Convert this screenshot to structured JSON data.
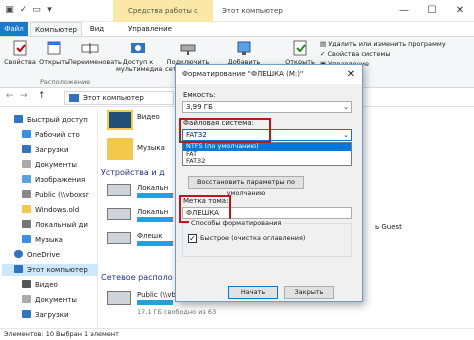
{
  "title_bar": {
    "context_tab": "Средства работы с дисками",
    "window_title": "Этот компьютер",
    "minimize": "—",
    "maximize": "☐",
    "close": "✕"
  },
  "tabs": [
    "Файл",
    "Компьютер",
    "Вид",
    "Управление"
  ],
  "ribbon": {
    "buttons": [
      "Свойства",
      "Открыть",
      "Переименовать",
      "Доступ к мультимедиа",
      "Подключить сетевой диск",
      "Добавить сетевое расположение",
      "Открыть"
    ],
    "group_label": "Расположение",
    "system_items": [
      "Удалить или изменить программу",
      "Свойства системы",
      "Управление"
    ]
  },
  "address": {
    "path": "Этот компьютер",
    "nav": [
      "←",
      "→",
      "↑"
    ]
  },
  "sidebar": {
    "items": [
      "Быстрый доступ",
      "Рабочий сто",
      "Загрузки",
      "Документы",
      "Изображения",
      "Public (\\\\vboxsr",
      "Windows.old",
      "Локальный ди",
      "Музыка",
      "OneDrive",
      "Этот компьютер",
      "Видео",
      "Документы",
      "Загрузки"
    ]
  },
  "main": {
    "folders": [
      "Видео",
      "Музыка"
    ],
    "devices_header": "Устройства и д",
    "devices": [
      "Локальн",
      "Локальн",
      "Флешк"
    ],
    "network_header": "Сетевое располо",
    "network_item": "Public (\\\\vbox",
    "network_size": "17,1 ГБ свободно из 63",
    "right_fragment": "ь Guest"
  },
  "status_bar": "Элементов: 10   Выбран 1 элемент",
  "dialog": {
    "title": "Форматирование \"ФЛЕШКА (M:)\"",
    "capacity_label": "Емкость:",
    "capacity_value": "3,99 ГБ",
    "fs_label": "Файловая система:",
    "fs_value": "FAT32",
    "fs_options": [
      "NTFS (по умолчанию)",
      "FAT",
      "FAT32"
    ],
    "restore_button": "Восстановить параметры по умолчанию",
    "volume_label": "Метка тома:",
    "volume_value": "ФЛЕШКА",
    "format_group": "Способы форматирования",
    "quick_format": "Быстрое (очистка оглавления)",
    "start_button": "Начать",
    "close_button": "Закрыть",
    "close_x": "✕",
    "check_mark": "✓"
  },
  "colors": {
    "accent": "#0078d7",
    "highlight_box": "#c0161b",
    "context_tab": "#fbe8a6",
    "file_tab": "#1979ca"
  }
}
